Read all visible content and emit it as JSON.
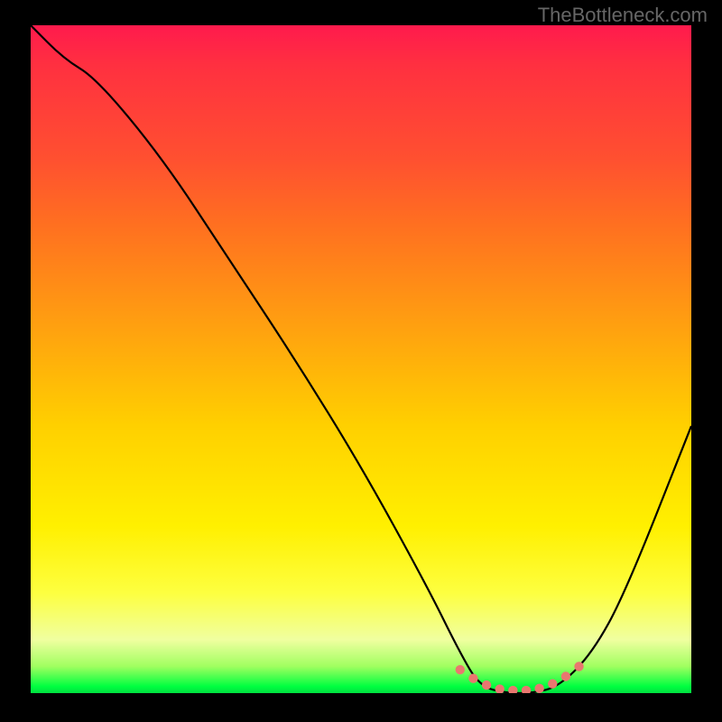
{
  "watermark": "TheBottleneck.com",
  "chart_data": {
    "type": "line",
    "title": "",
    "xlabel": "",
    "ylabel": "",
    "xlim": [
      0,
      100
    ],
    "ylim": [
      0,
      100
    ],
    "series": [
      {
        "name": "bottleneck-curve",
        "x": [
          0,
          5,
          10,
          20,
          30,
          40,
          50,
          60,
          65,
          68,
          72,
          76,
          80,
          85,
          90,
          100
        ],
        "y": [
          100,
          95,
          92,
          80,
          65,
          50,
          34,
          16,
          6,
          1,
          0,
          0,
          1,
          6,
          15,
          40
        ]
      }
    ],
    "highlight": {
      "name": "optimal-range",
      "x": [
        65,
        67,
        69,
        71,
        73,
        75,
        77,
        79,
        81,
        83
      ],
      "y": [
        3.5,
        2.2,
        1.2,
        0.6,
        0.4,
        0.4,
        0.7,
        1.4,
        2.5,
        4.0
      ]
    },
    "colors": {
      "curve": "#000000",
      "highlight": "#e9776f",
      "gradient_top": "#ff1a4d",
      "gradient_bottom": "#00e040"
    }
  }
}
